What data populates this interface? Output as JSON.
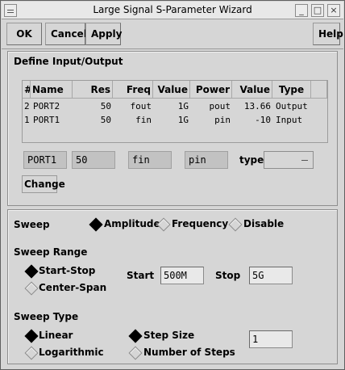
{
  "window": {
    "title": "Large Signal S-Parameter Wizard",
    "controls": [
      "_",
      "□",
      "×"
    ]
  },
  "toolbar": {
    "ok_label": "OK",
    "cancel_label": "Cancel",
    "apply_label": "Apply",
    "help_label": "Help"
  },
  "io": {
    "section_title": "Define Input/Output",
    "columns": [
      "#",
      "Name",
      "Res",
      "Freq",
      "Value",
      "Power",
      "Value",
      "Type"
    ],
    "rows": [
      {
        "num": "2",
        "name": "PORT2",
        "res": "50",
        "freq": "fout",
        "freq_value": "1G",
        "power": "pout",
        "power_value": "13.66",
        "type": "Output"
      },
      {
        "num": "1",
        "name": "PORT1",
        "res": "50",
        "freq": "fin",
        "freq_value": "1G",
        "power": "pin",
        "power_value": "-10",
        "type": "Input"
      }
    ],
    "edit": {
      "name": "PORT1",
      "res": "50",
      "freq": "fin",
      "power": "pin",
      "type_label": "type",
      "type_value": ""
    },
    "change_label": "Change"
  },
  "sweep": {
    "label": "Sweep",
    "options": [
      {
        "label": "Amplitude",
        "selected": true
      },
      {
        "label": "Frequency",
        "selected": false
      },
      {
        "label": "Disable",
        "selected": false
      }
    ],
    "range_title": "Sweep Range",
    "range_options": [
      {
        "label": "Start-Stop",
        "selected": true
      },
      {
        "label": "Center-Span",
        "selected": false
      }
    ],
    "start_label": "Start",
    "start_value": "500M",
    "stop_label": "Stop",
    "stop_value": "5G",
    "type_title": "Sweep Type",
    "type_options": [
      {
        "label": "Linear",
        "selected": true
      },
      {
        "label": "Logarithmic",
        "selected": false
      }
    ],
    "step_options": [
      {
        "label": "Step Size",
        "selected": true
      },
      {
        "label": "Number of Steps",
        "selected": false
      }
    ],
    "step_value": "1"
  }
}
